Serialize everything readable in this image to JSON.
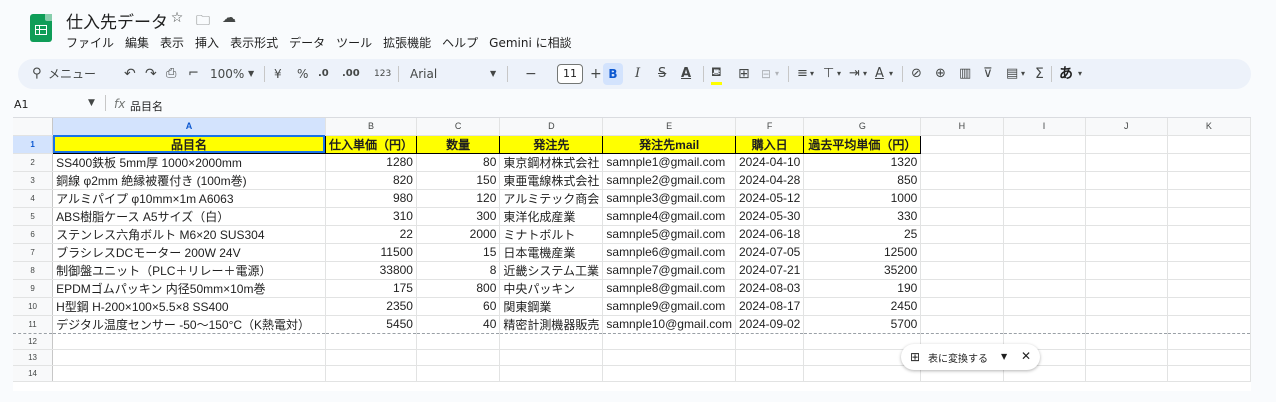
{
  "app": {
    "title": "仕入先データ",
    "title_icons": [
      "star-icon",
      "folder-icon",
      "cloud-icon"
    ],
    "menu": [
      "ファイル",
      "編集",
      "表示",
      "挿入",
      "表示形式",
      "データ",
      "ツール",
      "拡張機能",
      "ヘルプ",
      "Gemini に相談"
    ]
  },
  "toolbar": {
    "menu_search": "メニュー",
    "zoom": "100%",
    "currency": "¥",
    "percent": "%",
    "dec_decrease": ".0",
    "dec_increase": ".00",
    "format_123": "123",
    "font": "Arial",
    "minus": "−",
    "font_size": "11",
    "plus": "+",
    "bold": "B",
    "italic": "I",
    "strike": "S",
    "text_color": "A",
    "sigma": "Σ",
    "input_tool": "あ"
  },
  "formula_bar": {
    "cell_ref": "A1",
    "fx": "fx",
    "content": "品目名"
  },
  "sheet": {
    "columns": [
      "A",
      "B",
      "C",
      "D",
      "E",
      "F",
      "G",
      "H",
      "I",
      "J",
      "K"
    ],
    "header_row": [
      "品目名",
      "仕入単価（円）",
      "数量",
      "発注先",
      "発注先mail",
      "購入日",
      "過去平均単価（円）"
    ],
    "rows": [
      [
        "SS400鉄板 5mm厚 1000×2000mm",
        "1280",
        "80",
        "東京鋼材株式会社",
        "samnple1@gmail.com",
        "2024-04-10",
        "1320"
      ],
      [
        "銅線 φ2mm 絶縁被覆付き (100m巻)",
        "820",
        "150",
        "東亜電線株式会社",
        "samnple2@gmail.com",
        "2024-04-28",
        "850"
      ],
      [
        "アルミパイプ φ10mm×1m A6063",
        "980",
        "120",
        "アルミテック商会",
        "samnple3@gmail.com",
        "2024-05-12",
        "1000"
      ],
      [
        "ABS樹脂ケース A5サイズ（白）",
        "310",
        "300",
        "東洋化成産業",
        "samnple4@gmail.com",
        "2024-05-30",
        "330"
      ],
      [
        "ステンレス六角ボルト M6×20 SUS304",
        "22",
        "2000",
        "ミナトボルト",
        "samnple5@gmail.com",
        "2024-06-18",
        "25"
      ],
      [
        "ブラシレスDCモーター 200W 24V",
        "11500",
        "15",
        "日本電機産業",
        "samnple6@gmail.com",
        "2024-07-05",
        "12500"
      ],
      [
        "制御盤ユニット（PLC＋リレー＋電源）",
        "33800",
        "8",
        "近畿システム工業",
        "samnple7@gmail.com",
        "2024-07-21",
        "35200"
      ],
      [
        "EPDMゴムパッキン 内径50mm×10m巻",
        "175",
        "800",
        "中央パッキン",
        "samnple8@gmail.com",
        "2024-08-03",
        "190"
      ],
      [
        "H型鋼 H-200×100×5.5×8 SS400",
        "2350",
        "60",
        "関東鋼業",
        "samnple9@gmail.com",
        "2024-08-17",
        "2450"
      ],
      [
        "デジタル温度センサー -50〜150°C（K熱電対）",
        "5450",
        "40",
        "精密計測機器販売",
        "samnple10@gmail.com",
        "2024-09-02",
        "5700"
      ]
    ],
    "row_numbers": [
      "1",
      "2",
      "3",
      "4",
      "5",
      "6",
      "7",
      "8",
      "9",
      "10",
      "11",
      "12",
      "13",
      "14"
    ]
  },
  "convert_chip": {
    "label": "表に変換する"
  },
  "colors": {
    "header_fill": "#ffff00",
    "selection": "#1a73e8",
    "sheets_green": "#0f9d58"
  }
}
